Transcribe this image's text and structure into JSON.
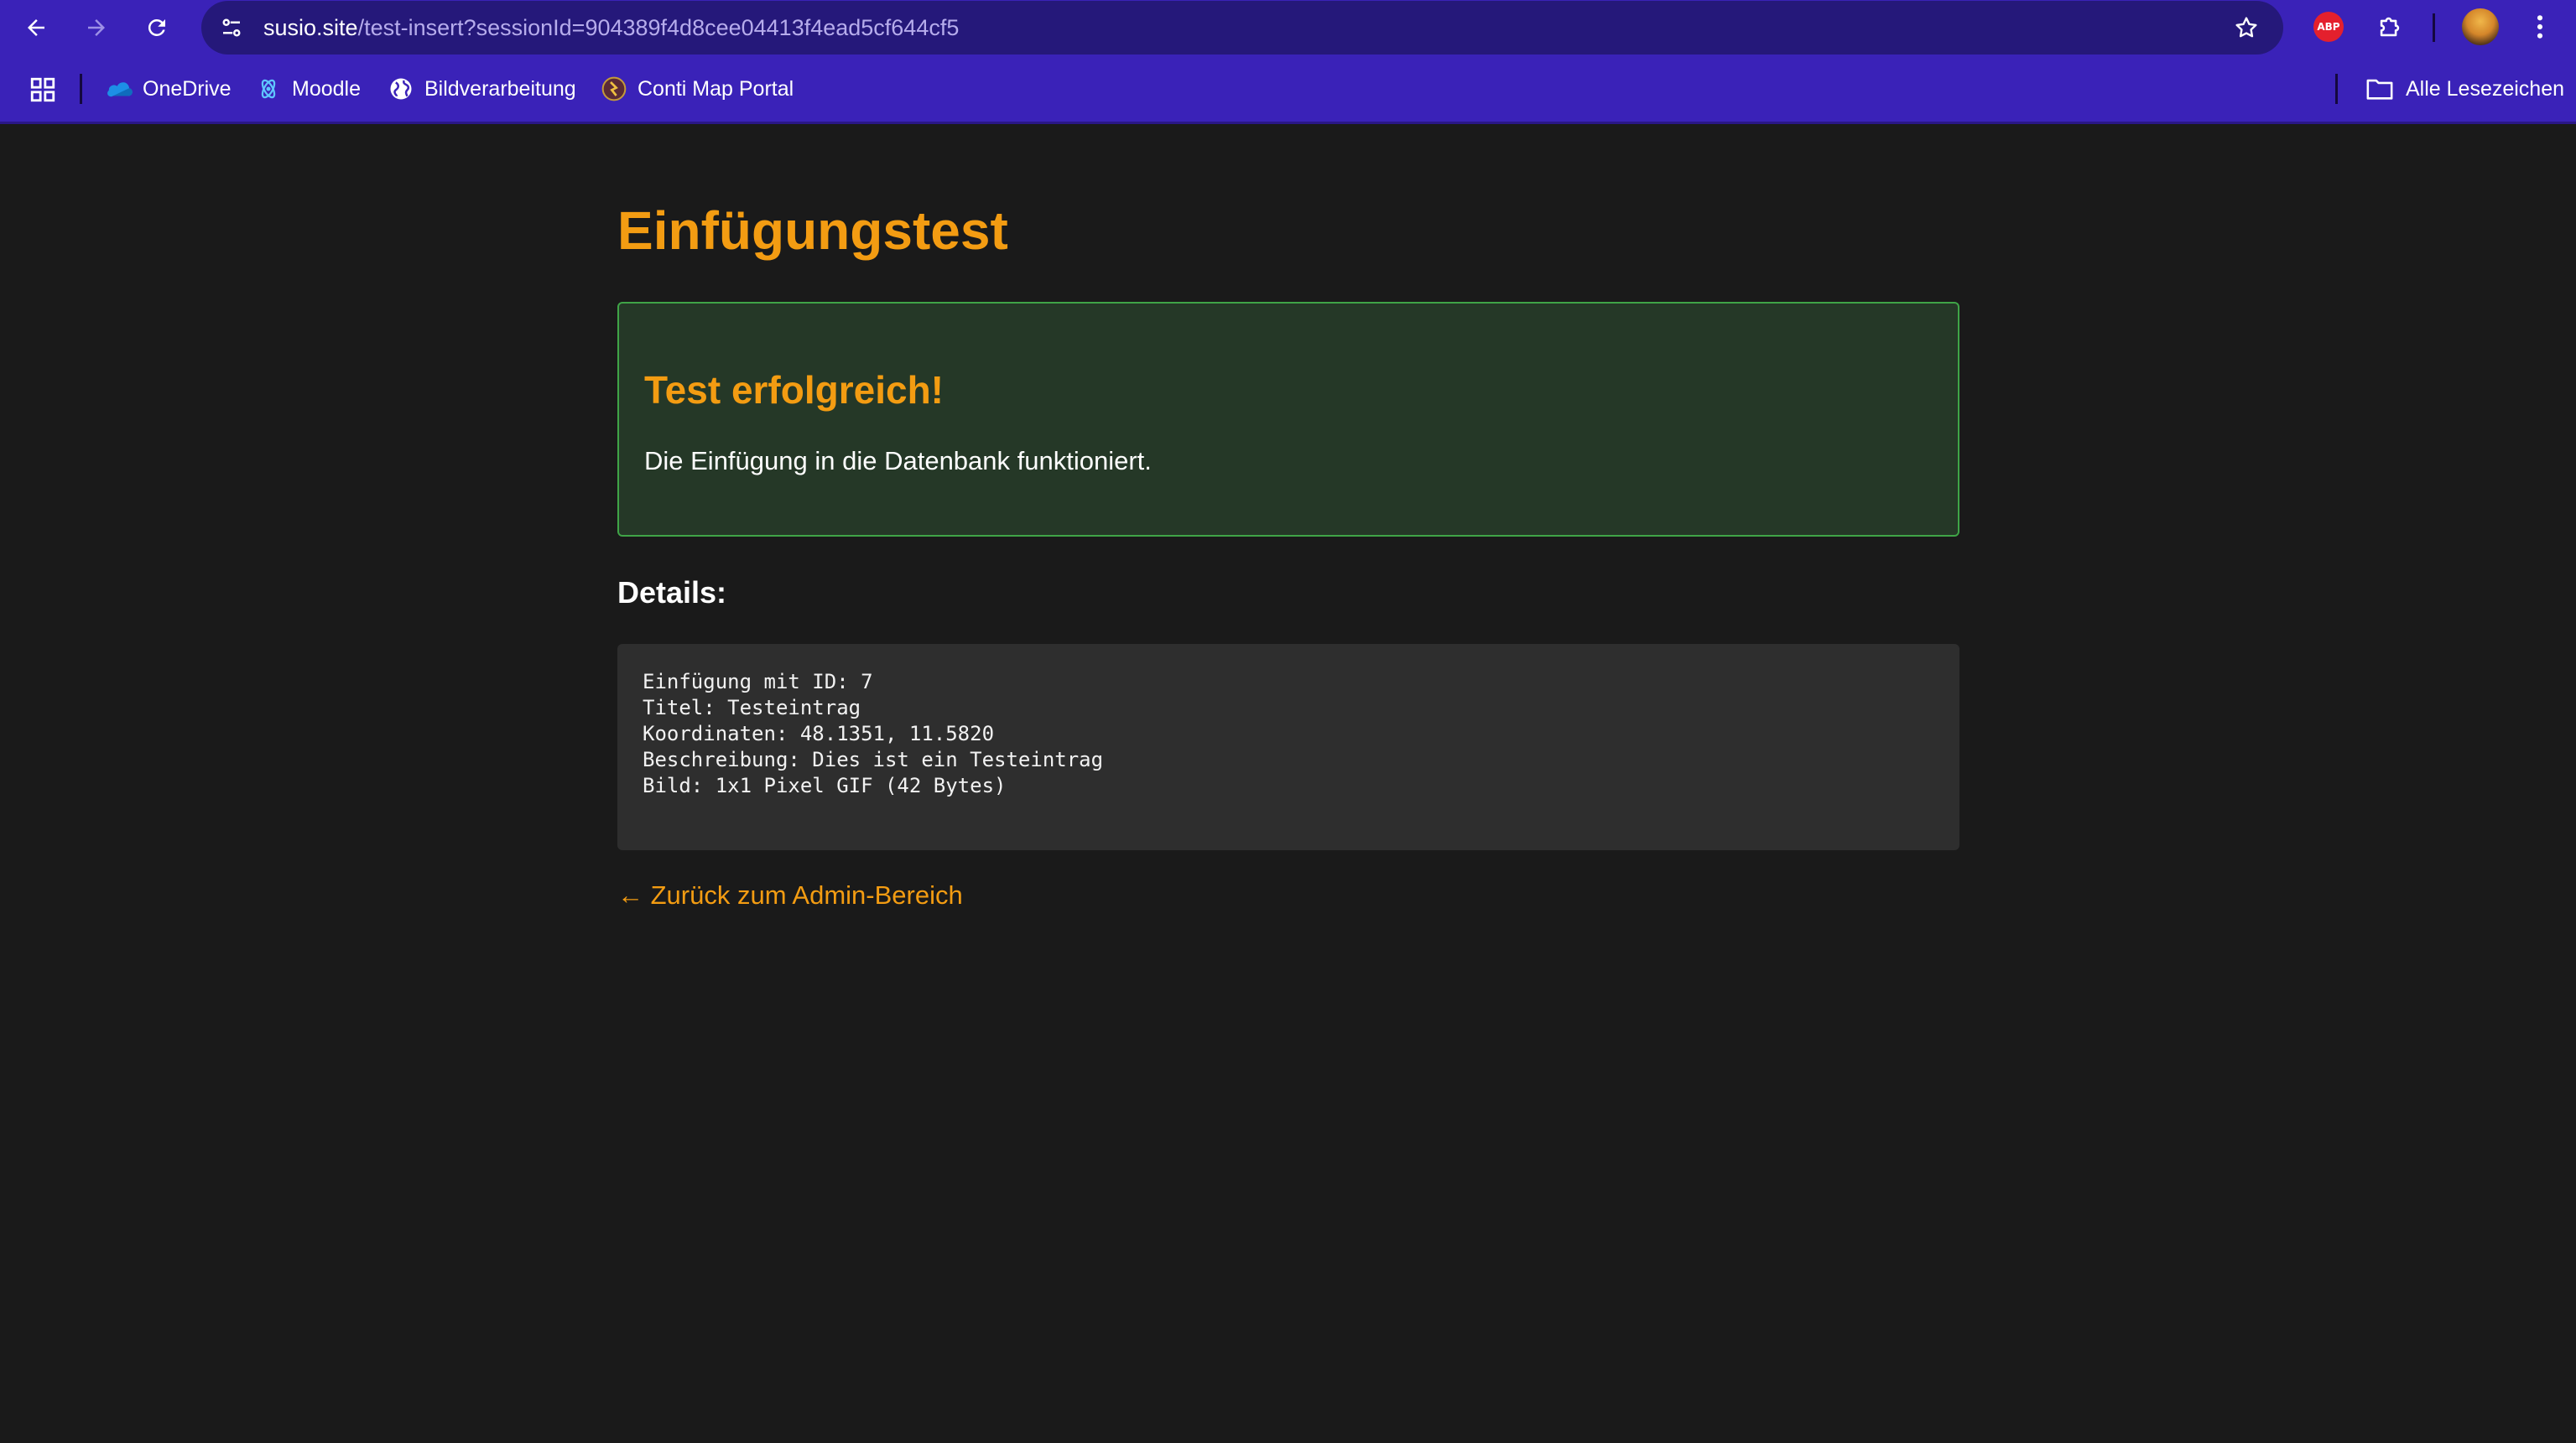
{
  "browser": {
    "url_host": "susio.site",
    "url_path": "/test-insert?sessionId=904389f4d8cee04413f4ead5cf644cf5",
    "extension_badge": "ABP",
    "bookmarks": [
      {
        "label": "OneDrive",
        "icon": "onedrive-icon"
      },
      {
        "label": "Moodle",
        "icon": "moodle-icon"
      },
      {
        "label": "Bildverarbeitung",
        "icon": "globe-icon"
      },
      {
        "label": "Conti Map Portal",
        "icon": "conti-icon"
      }
    ],
    "all_bookmarks_label": "Alle Lesezeichen"
  },
  "page": {
    "title": "Einfügungstest",
    "success": {
      "title": "Test erfolgreich!",
      "message": "Die Einfügung in die Datenbank funktioniert."
    },
    "details_heading": "Details:",
    "details_lines": [
      "Einfügung mit ID: 7",
      "Titel: Testeintrag",
      "Koordinaten: 48.1351, 11.5820",
      "Beschreibung: Dies ist ein Testeintrag",
      "Bild: 1x1 Pixel GIF (42 Bytes)"
    ],
    "back_link": "← Zurück zum Admin-Bereich"
  },
  "colors": {
    "accent": "#f39c12",
    "success_border": "#3fa447",
    "success_bg": "#253827",
    "page_bg": "#1a1a1a",
    "chrome_bg": "#3a22b8"
  }
}
